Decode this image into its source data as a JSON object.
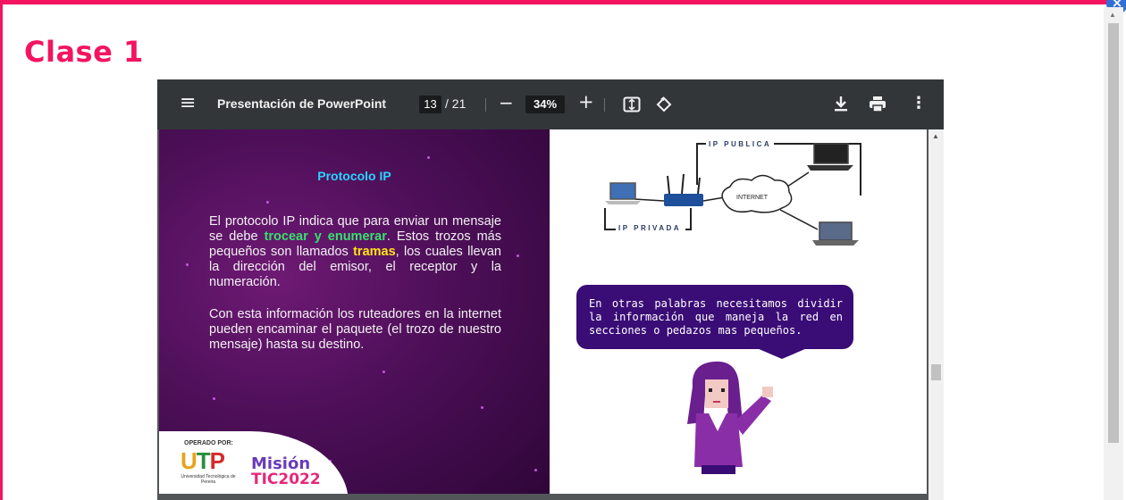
{
  "page": {
    "title": "Clase 1",
    "close_icon": "close-icon"
  },
  "viewer": {
    "doc_title": "Presentación de PowerPoint",
    "page_current": "13",
    "page_total": "/ 21",
    "zoom": "34%",
    "icons": [
      "menu-icon",
      "zoom-out-icon",
      "zoom-in-icon",
      "fit-page-icon",
      "rotate-icon",
      "download-icon",
      "print-icon",
      "more-icon"
    ]
  },
  "slide": {
    "title": "Protocolo IP",
    "para1_pre": "El protocolo IP indica que para enviar un mensaje se debe ",
    "para1_hl1": "trocear y enumerar",
    "para1_mid": ".  Estos trozos más pequeños son llamados ",
    "para1_hl2": "tramas",
    "para1_post": ", los cuales llevan la dirección del emisor, el receptor y la numeración.",
    "para2": "Con esta información los ruteadores en la internet pueden encaminar el paquete (el trozo de nuestro mensaje) hasta su destino.",
    "diagram": {
      "public_label": "IP PUBLICA",
      "private_label": "IP PRIVADA",
      "cloud_label": "INTERNET"
    },
    "bubble": "En otras palabras necesitamos dividir la información que maneja la red en secciones o pedazos mas pequeños.",
    "logos": {
      "operated_by": "OPERADO POR:",
      "utp": "UTP",
      "utp_sub": "Universidad Tecnológica de Pereira",
      "mision": "Misión",
      "tic": "TIC2022"
    },
    "colors": {
      "accent": "#f4145f",
      "slide_bg": "#4d0f58",
      "title": "#29d4ff",
      "highlight_green": "#35e36b",
      "highlight_yellow": "#ffe418",
      "bubble": "#3a0c76"
    }
  }
}
